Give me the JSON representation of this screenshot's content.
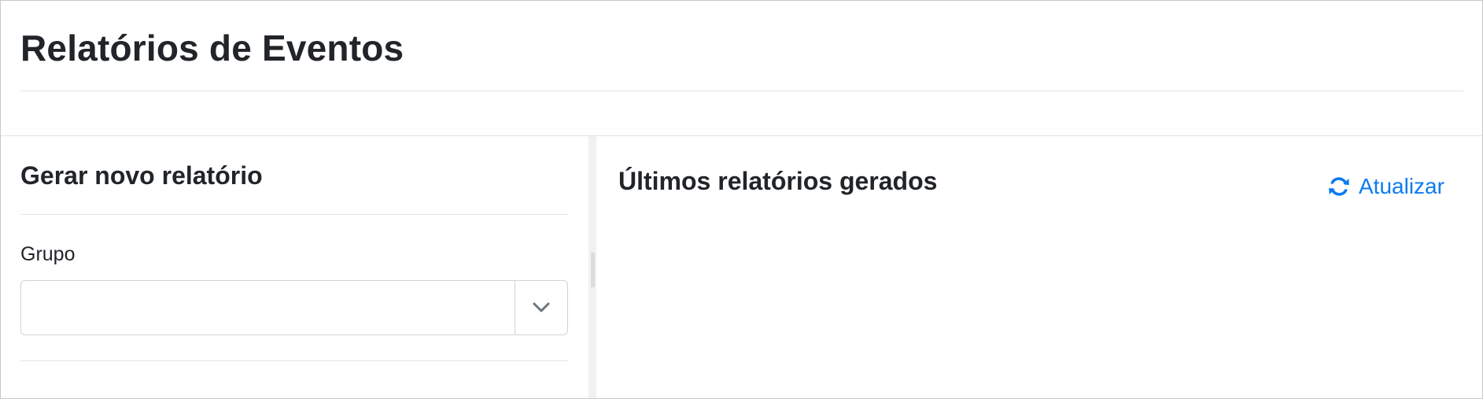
{
  "page": {
    "title": "Relatórios de Eventos"
  },
  "generate_panel": {
    "title": "Gerar novo relatório",
    "group_label": "Grupo",
    "group_value": ""
  },
  "latest_panel": {
    "title": "Últimos relatórios gerados",
    "refresh_label": "Atualizar",
    "refresh_icon": "refresh-icon"
  },
  "colors": {
    "accent": "#0d7bf2",
    "text": "#212529",
    "border": "#ced4da",
    "divider": "#dee2e6"
  }
}
